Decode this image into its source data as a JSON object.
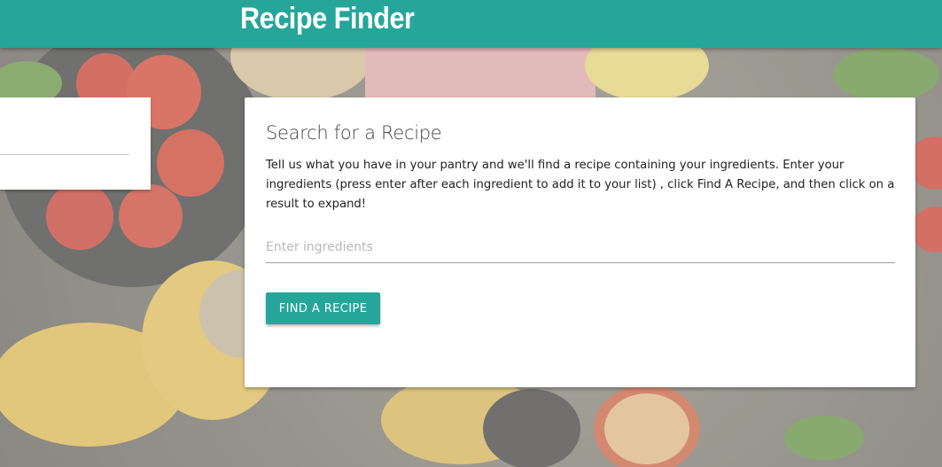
{
  "header": {
    "brand": "Recipe Finder"
  },
  "search_card": {
    "title": "Search for a Recipe",
    "description": "Tell us what you have in your pantry and we'll find a recipe containing your ingredients. Enter your ingredients (press enter after each ingredient to add it to your list) , click Find A Recipe, and then click on a result to expand!",
    "input_placeholder": "Enter ingredients",
    "input_value": "",
    "button_label": "FIND A RECIPE"
  },
  "colors": {
    "accent": "#26a69a",
    "card_bg": "#ffffff",
    "text": "#222222"
  }
}
